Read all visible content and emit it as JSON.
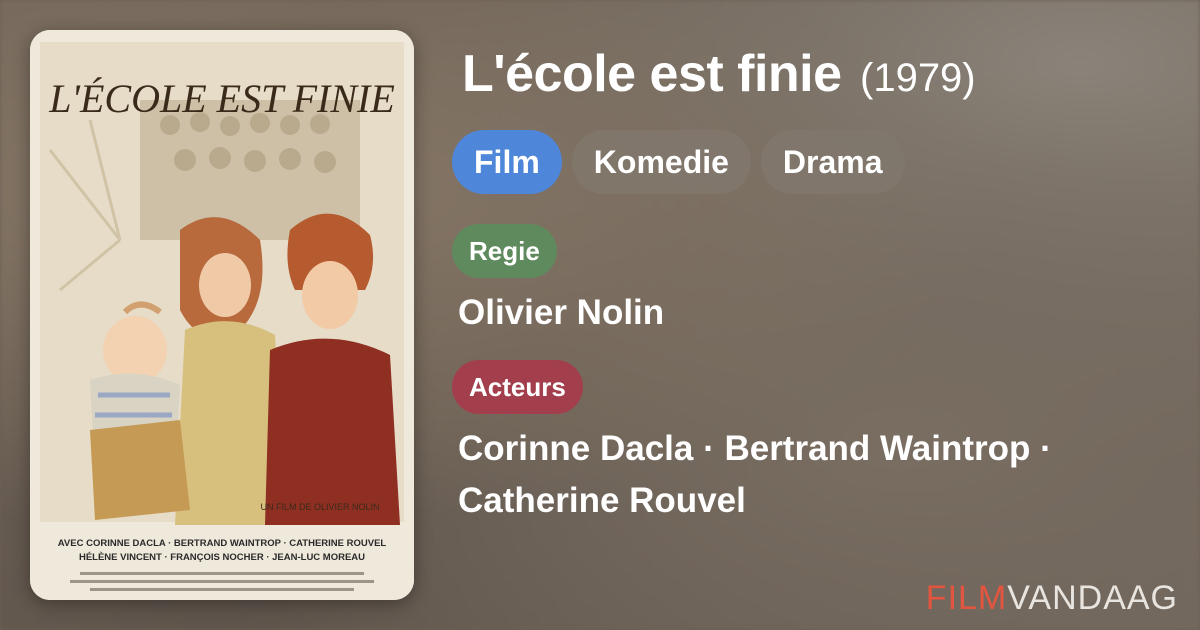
{
  "title": "L'école est finie",
  "year": "(1979)",
  "genres": [
    "Film",
    "Komedie",
    "Drama"
  ],
  "director_label": "Regie",
  "director": "Olivier Nolin",
  "actors_label": "Acteurs",
  "actors": "Corinne Dacla · Bertrand Waintrop · Catherine Rouvel",
  "poster": {
    "title_text": "L'ÉCOLE EST FINIE",
    "credit": "UN FILM DE OLIVIER NOLIN",
    "cast_line_1": "AVEC CORINNE DACLA · BERTRAND WAINTROP · CATHERINE ROUVEL",
    "cast_line_2": "HÉLÈNE VINCENT · FRANÇOIS NOCHER · JEAN-LUC MOREAU"
  },
  "logo": {
    "part1": "FILM",
    "part2": "VANDAAG"
  },
  "colors": {
    "film_pill": "#4e86d9",
    "regie_pill": "#5f8a5e",
    "acteurs_pill": "#a33f4c",
    "logo_red": "#e4553f"
  }
}
